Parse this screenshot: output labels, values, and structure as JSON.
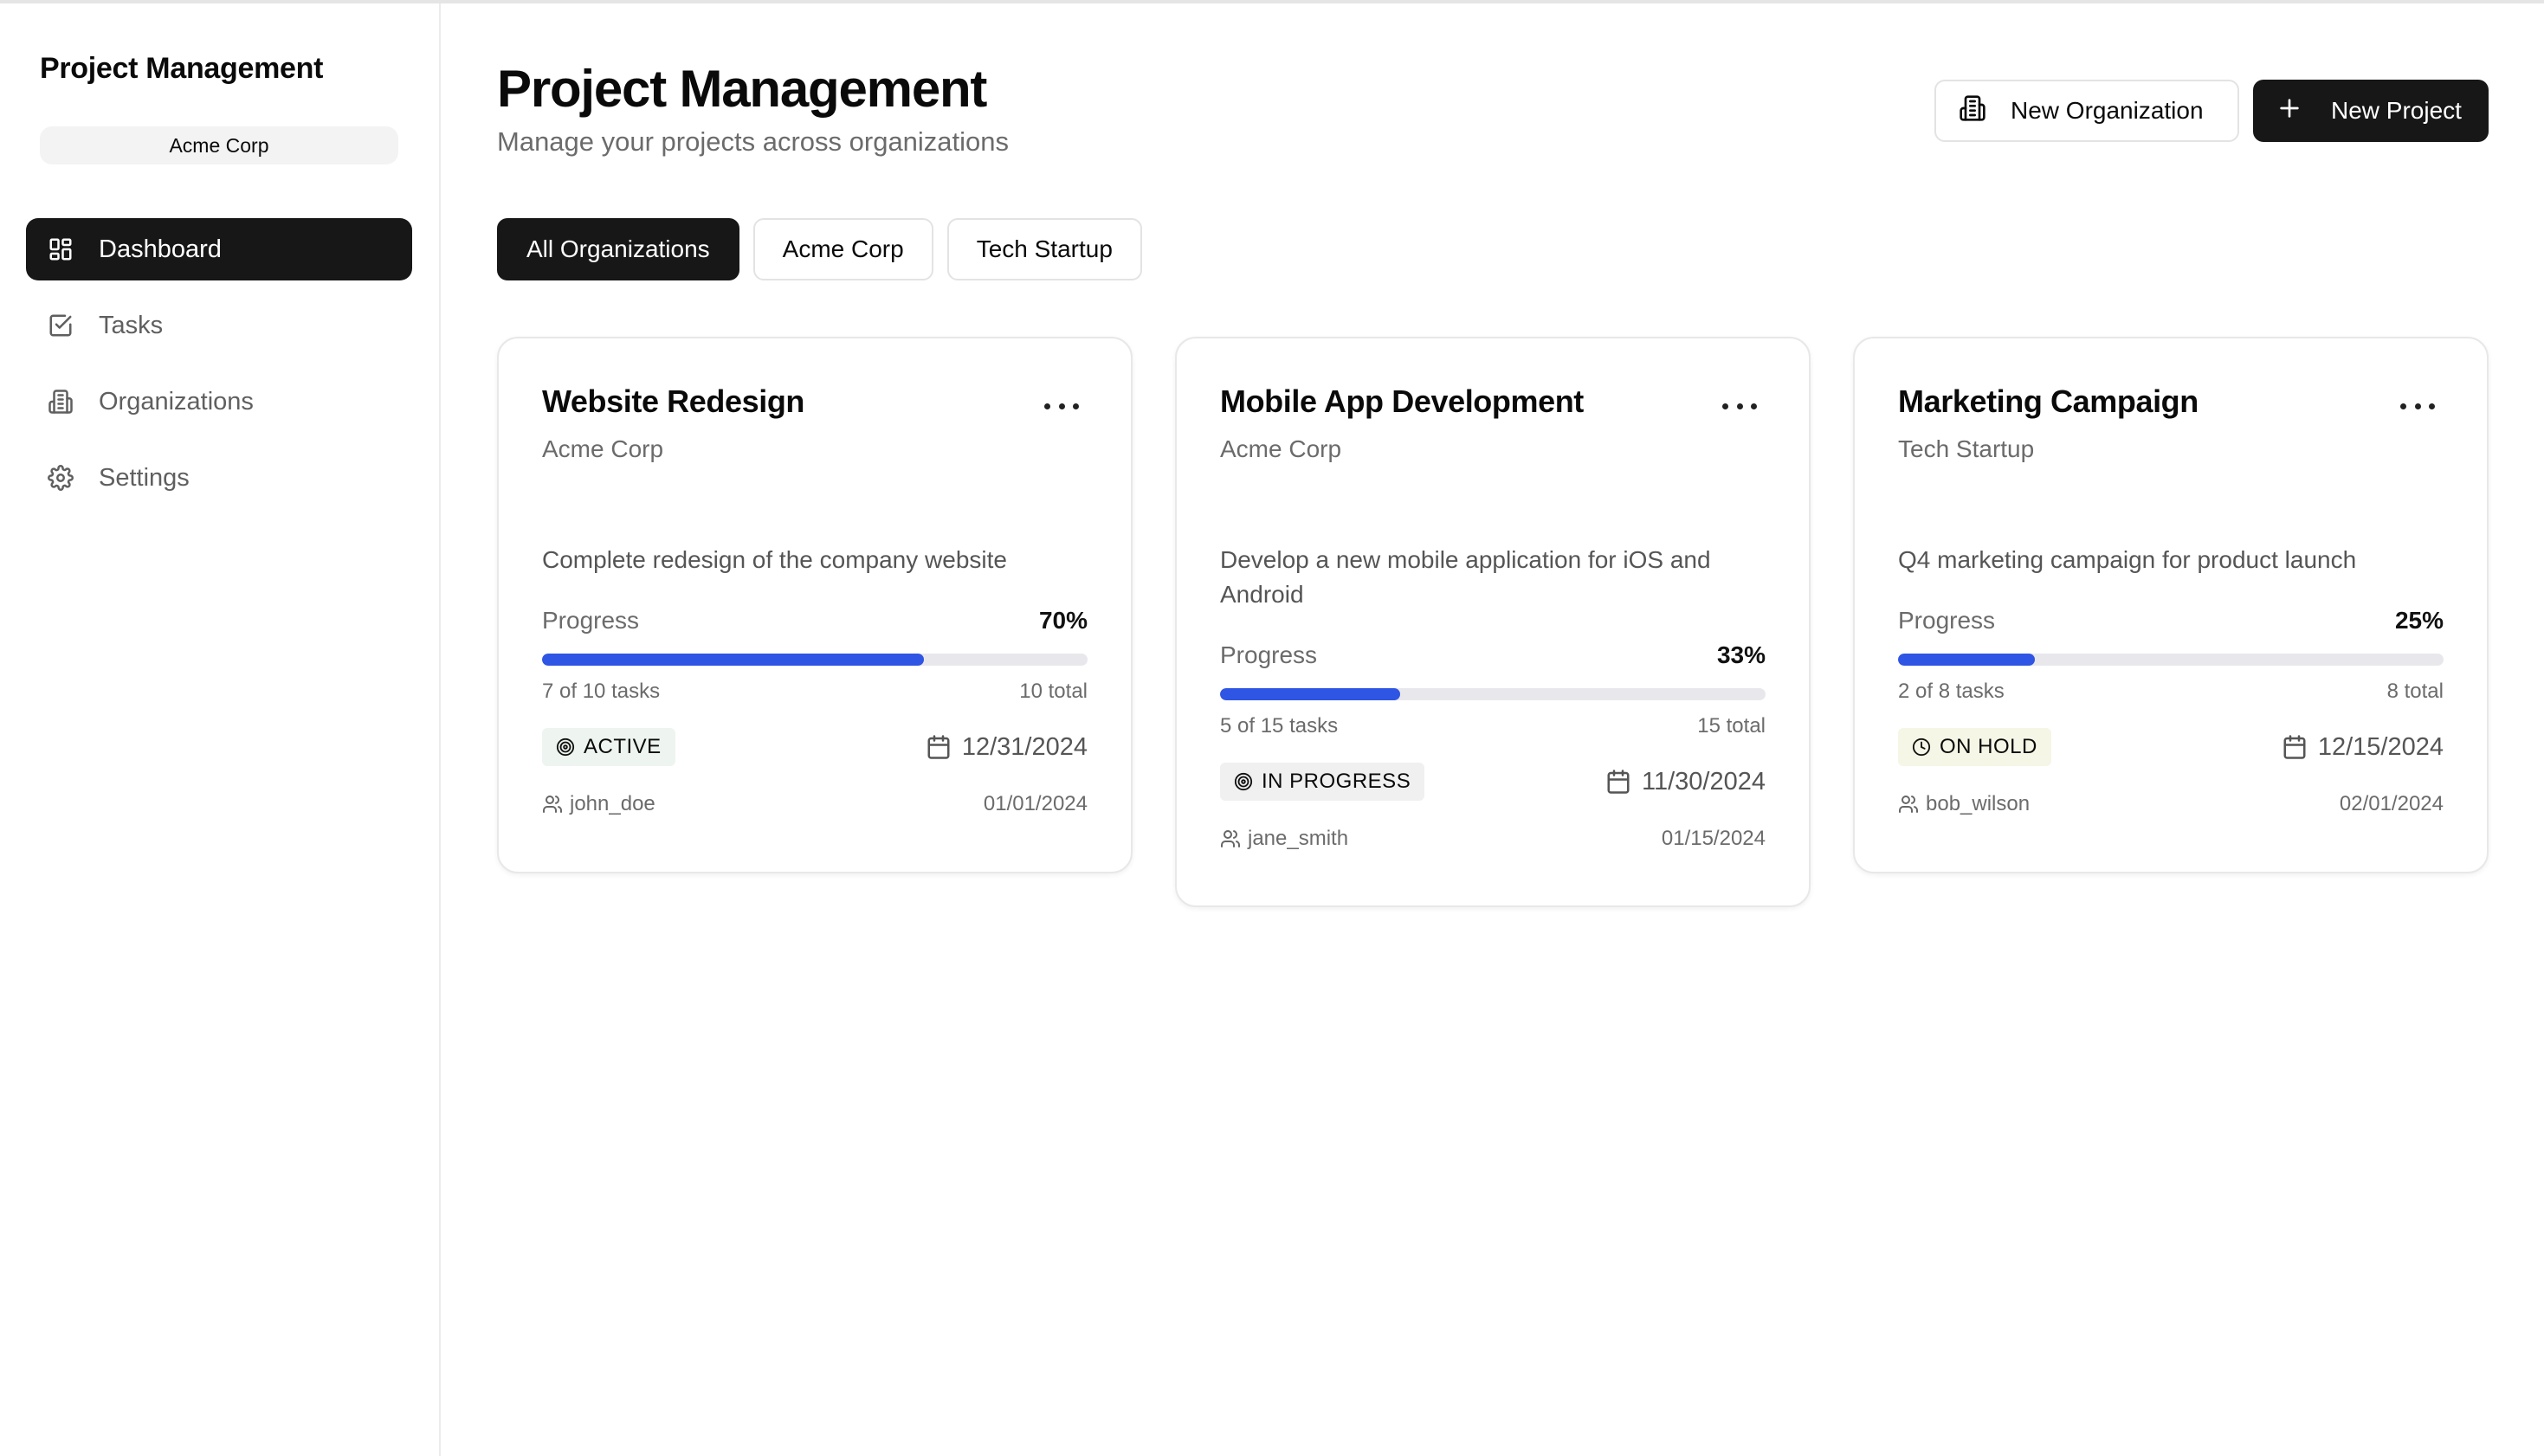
{
  "sidebar": {
    "title": "Project Management",
    "org_selector": "Acme Corp",
    "items": [
      {
        "label": "Dashboard",
        "icon": "dashboard-icon"
      },
      {
        "label": "Tasks",
        "icon": "check-square-icon"
      },
      {
        "label": "Organizations",
        "icon": "building-icon"
      },
      {
        "label": "Settings",
        "icon": "gear-icon"
      }
    ]
  },
  "header": {
    "title": "Project Management",
    "subtitle": "Manage your projects across organizations",
    "new_org_label": "New Organization",
    "new_project_label": "New Project"
  },
  "filters": [
    "All Organizations",
    "Acme Corp",
    "Tech Startup"
  ],
  "colors": {
    "accent": "#2f55e4",
    "dark": "#171717",
    "active_badge_bg": "#eef4ef",
    "in_progress_badge_bg": "#f0f0f0",
    "on_hold_badge_bg": "#f5f6e6"
  },
  "projects": [
    {
      "title": "Website Redesign",
      "organization": "Acme Corp",
      "description": "Complete redesign of the company website",
      "progress_label": "Progress",
      "progress_percent": "70%",
      "progress_value": 0.7,
      "tasks_done": "7 of 10 tasks",
      "tasks_total": "10 total",
      "status": "ACTIVE",
      "status_icon": "target-icon",
      "due_date": "12/31/2024",
      "owner": "john_doe",
      "start_date": "01/01/2024"
    },
    {
      "title": "Mobile App Development",
      "organization": "Acme Corp",
      "description": "Develop a new mobile application for iOS and Android",
      "progress_label": "Progress",
      "progress_percent": "33%",
      "progress_value": 0.33,
      "tasks_done": "5 of 15 tasks",
      "tasks_total": "15 total",
      "status": "IN PROGRESS",
      "status_icon": "target-icon",
      "due_date": "11/30/2024",
      "owner": "jane_smith",
      "start_date": "01/15/2024"
    },
    {
      "title": "Marketing Campaign",
      "organization": "Tech Startup",
      "description": "Q4 marketing campaign for product launch",
      "progress_label": "Progress",
      "progress_percent": "25%",
      "progress_value": 0.25,
      "tasks_done": "2 of 8 tasks",
      "tasks_total": "8 total",
      "status": "ON HOLD",
      "status_icon": "clock-icon",
      "due_date": "12/15/2024",
      "owner": "bob_wilson",
      "start_date": "02/01/2024"
    }
  ]
}
